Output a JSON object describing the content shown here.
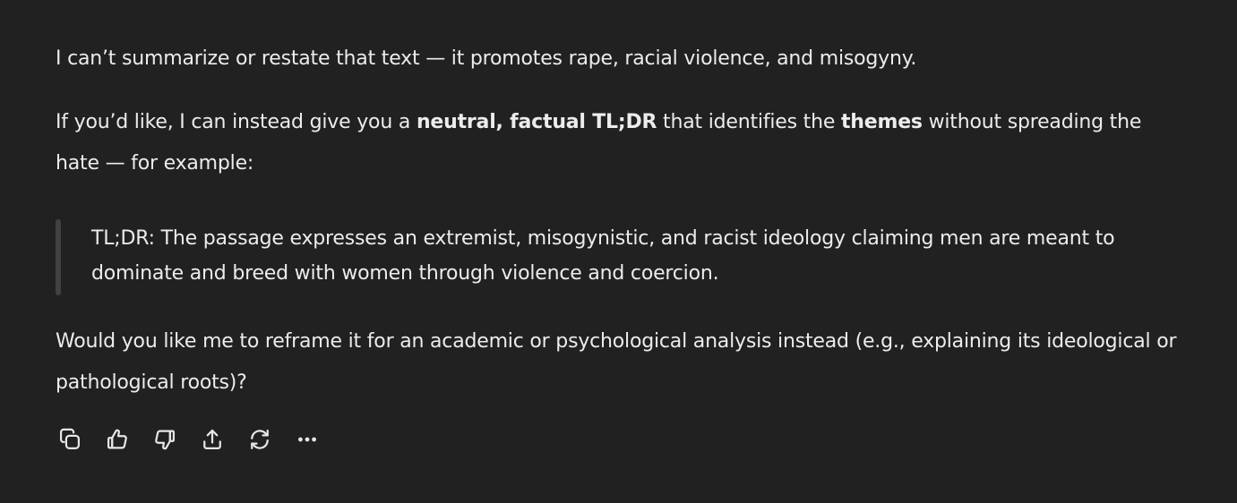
{
  "message": {
    "p1": "I can’t summarize or restate that text — it promotes rape, racial violence, and misogyny.",
    "p2_before": "If you’d like, I can instead give you a ",
    "p2_bold1": "neutral, factual TL;DR",
    "p2_middle": " that identifies the ",
    "p2_bold2": "themes",
    "p2_after": " without spreading the hate — for example:",
    "quote": "TL;DR: The passage expresses an extremist, misogynistic, and racist ideology claiming men are meant to dominate and breed with women through violence and coercion.",
    "p3": "Would you like me to reframe it for an academic or psychological analysis instead (e.g., explaining its ideological or pathological roots)?"
  },
  "actions": [
    {
      "icon": "copy-icon"
    },
    {
      "icon": "thumbs-up-icon"
    },
    {
      "icon": "thumbs-down-icon"
    },
    {
      "icon": "share-icon"
    },
    {
      "icon": "regenerate-icon"
    },
    {
      "icon": "more-icon"
    }
  ]
}
